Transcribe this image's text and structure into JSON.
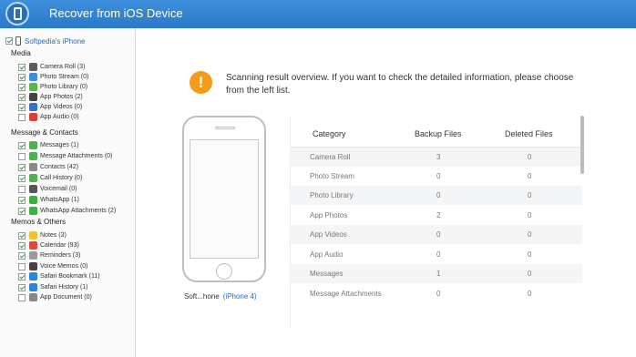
{
  "window": {
    "title": "Recover from iOS Device"
  },
  "sidebar": {
    "device_label": "Softpedia's iPhone",
    "sections": [
      {
        "title": "Media",
        "items": [
          {
            "label": "Camera Roll (3)",
            "checked": true,
            "icon": "camera-icon",
            "color": "#5b5b5b"
          },
          {
            "label": "Photo Stream (0)",
            "checked": true,
            "icon": "photo-stream-icon",
            "color": "#3a8fd8"
          },
          {
            "label": "Photo Library (0)",
            "checked": true,
            "icon": "photo-library-icon",
            "color": "#5ab44a"
          },
          {
            "label": "App Photos (2)",
            "checked": true,
            "icon": "app-photos-icon",
            "color": "#444444"
          },
          {
            "label": "App Videos (0)",
            "checked": true,
            "icon": "app-videos-icon",
            "color": "#3a6fc8"
          },
          {
            "label": "App Audio (0)",
            "checked": false,
            "icon": "app-audio-icon",
            "color": "#d9403a"
          }
        ]
      },
      {
        "title": "Message & Contacts",
        "items": [
          {
            "label": "Messages (1)",
            "checked": true,
            "icon": "messages-icon",
            "color": "#4caf50"
          },
          {
            "label": "Message Attachments (0)",
            "checked": false,
            "icon": "message-attachments-icon",
            "color": "#4caf50"
          },
          {
            "label": "Contacts (42)",
            "checked": true,
            "icon": "contacts-icon",
            "color": "#8a8a8a"
          },
          {
            "label": "Call History (0)",
            "checked": true,
            "icon": "call-history-icon",
            "color": "#4caf50"
          },
          {
            "label": "Voicemail (0)",
            "checked": false,
            "icon": "voicemail-icon",
            "color": "#555555"
          },
          {
            "label": "WhatsApp (1)",
            "checked": true,
            "icon": "whatsapp-icon",
            "color": "#3cb043"
          },
          {
            "label": "WhatsApp Attachments (2)",
            "checked": true,
            "icon": "whatsapp-attachments-icon",
            "color": "#3cb043"
          }
        ]
      },
      {
        "title": "Memos & Others",
        "items": [
          {
            "label": "Notes (3)",
            "checked": true,
            "icon": "notes-icon",
            "color": "#f2c230"
          },
          {
            "label": "Calendar (93)",
            "checked": true,
            "icon": "calendar-icon",
            "color": "#e2473c"
          },
          {
            "label": "Reminders (3)",
            "checked": true,
            "icon": "reminders-icon",
            "color": "#9a9a9a"
          },
          {
            "label": "Voice Memos (0)",
            "checked": false,
            "icon": "voice-memos-icon",
            "color": "#444444"
          },
          {
            "label": "Safari Bookmark (11)",
            "checked": true,
            "icon": "safari-bookmark-icon",
            "color": "#2f86d8"
          },
          {
            "label": "Safari History (1)",
            "checked": true,
            "icon": "safari-history-icon",
            "color": "#2f86d8"
          },
          {
            "label": "App Document (0)",
            "checked": false,
            "icon": "app-document-icon",
            "color": "#888888"
          }
        ]
      }
    ]
  },
  "main": {
    "alert_icon": "!",
    "overview_text": "Scanning result overview. If you want to check the detailed information, please choose from the left list.",
    "device_caption": "Soft...hone",
    "device_model": "(iPhone 4)",
    "table": {
      "headers": [
        "Category",
        "Backup Files",
        "Deleted Files"
      ],
      "rows": [
        [
          "Camera Roll",
          "3",
          "0"
        ],
        [
          "Photo Stream",
          "0",
          "0"
        ],
        [
          "Photo Library",
          "0",
          "0"
        ],
        [
          "App Photos",
          "2",
          "0"
        ],
        [
          "App Videos",
          "0",
          "0"
        ],
        [
          "App Audio",
          "0",
          "0"
        ],
        [
          "Messages",
          "1",
          "0"
        ],
        [
          "Message Attachments",
          "0",
          "0"
        ]
      ]
    }
  }
}
